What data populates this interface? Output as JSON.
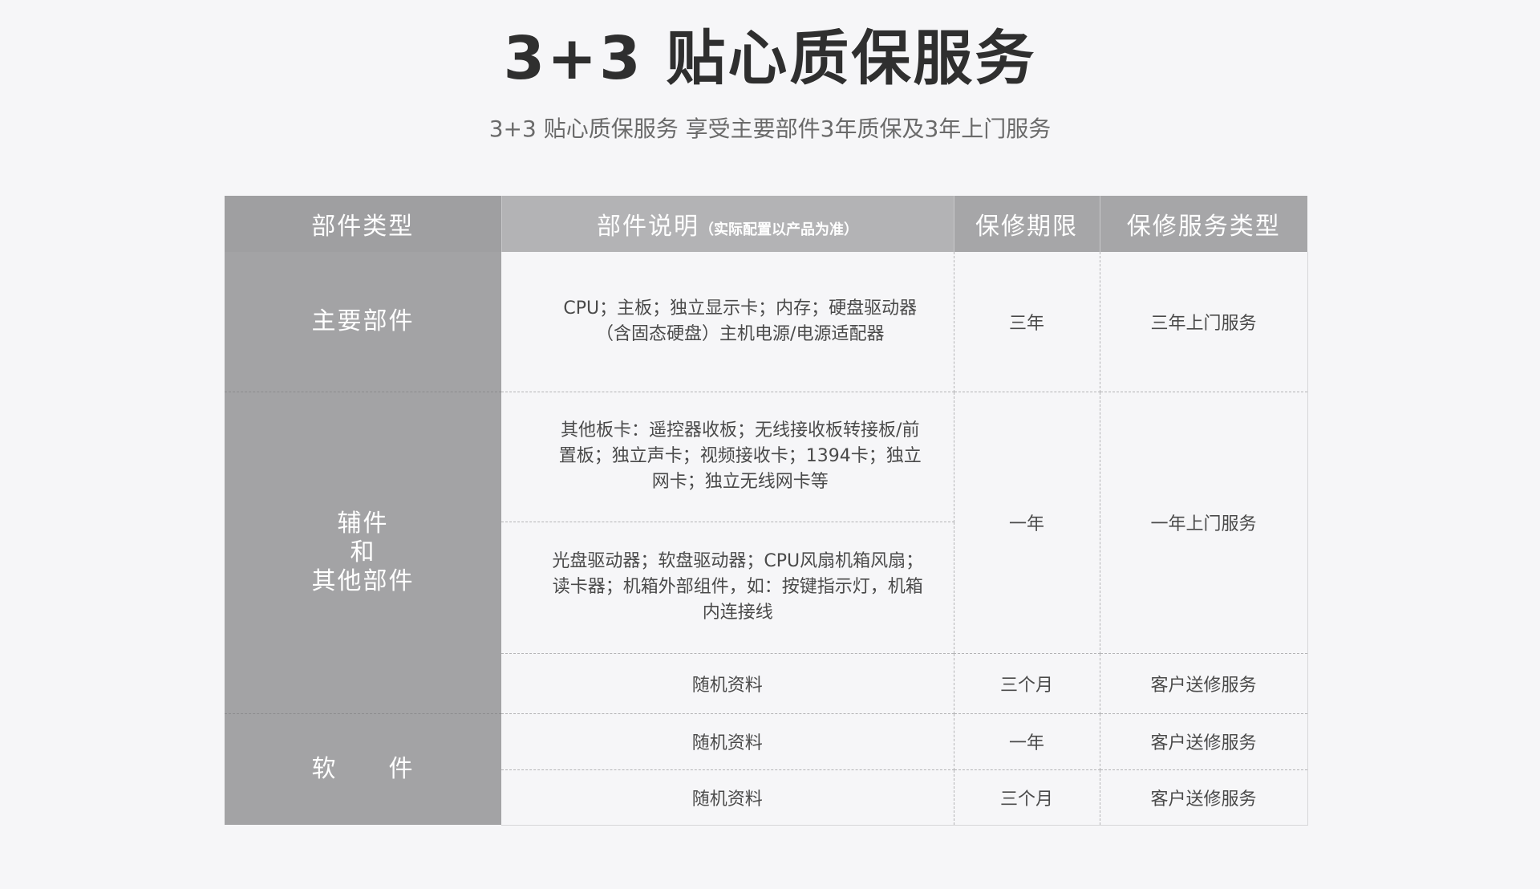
{
  "title": "3+3 贴心质保服务",
  "subtitle": "3+3 贴心质保服务 享受主要部件3年质保及3年上门服务",
  "table": {
    "headers": {
      "part_type": "部件类型",
      "part_desc": "部件说明",
      "part_desc_note": "（实际配置以产品为准）",
      "period": "保修期限",
      "service_type": "保修服务类型"
    },
    "main": {
      "category": "主要部件",
      "desc_line1": "CPU；主板；独立显示卡；内存；硬盘驱动器",
      "desc_line2": "（含固态硬盘）主机电源/电源适配器",
      "period": "三年",
      "service": "三年上门服务"
    },
    "aux": {
      "category_line1": "辅件",
      "category_line2": "和",
      "category_line3": "其他部件",
      "desc1_line1": "其他板卡：遥控器收板；无线接收板转接板/前",
      "desc1_line2": "置板；独立声卡；视频接收卡；1394卡；独立",
      "desc1_line3": "网卡；独立无线网卡等",
      "desc2_line1": "光盘驱动器；软盘驱动器；CPU风扇机箱风扇；",
      "desc2_line2": "读卡器；机箱外部组件，如：按键指示灯，机箱",
      "desc2_line3": "内连接线",
      "period": "一年",
      "service": "一年上门服务",
      "docs_desc": "随机资料",
      "docs_period": "三个月",
      "docs_service": "客户送修服务"
    },
    "software": {
      "category": "软　　件",
      "row1_desc": "随机资料",
      "row1_period": "一年",
      "row1_service": "客户送修服务",
      "row2_desc": "随机资料",
      "row2_period": "三个月",
      "row2_service": "客户送修服务"
    }
  }
}
